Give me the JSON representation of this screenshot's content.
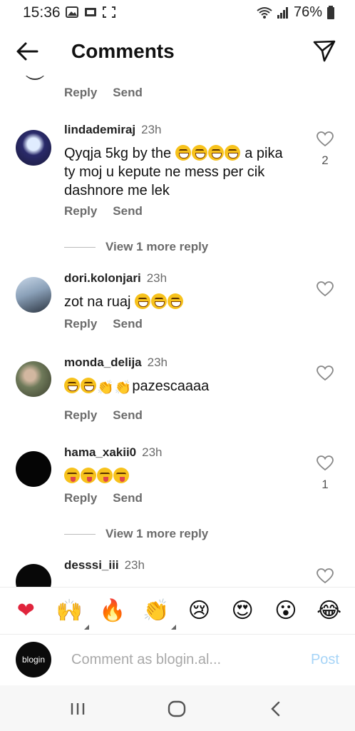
{
  "status": {
    "time": "15:36",
    "battery": "76%"
  },
  "header": {
    "title": "Comments"
  },
  "top": {
    "reply": "Reply",
    "send": "Send"
  },
  "comments": [
    {
      "username": "lindademiraj",
      "time": "23h",
      "text_lines": [
        "Qyqja 5kg by the",
        "a pika",
        "ty moj u kepute ne mess per cik",
        "dashnore me lek"
      ],
      "reply": "Reply",
      "send": "Send",
      "likes": "2"
    },
    {
      "username": "dori.kolonjari",
      "time": "23h",
      "text": "zot na ruaj",
      "reply": "Reply",
      "send": "Send"
    },
    {
      "username": "monda_delija",
      "time": "23h",
      "text": "pazescaaaa",
      "reply": "Reply",
      "send": "Send"
    },
    {
      "username": "hama_xakii0",
      "time": "23h",
      "reply": "Reply",
      "send": "Send",
      "likes": "1"
    },
    {
      "username": "desssi_iii",
      "time": "23h"
    }
  ],
  "view_more": [
    "View 1 more reply",
    "View 1 more reply"
  ],
  "reactions": [
    {
      "icon": "red-heart-icon",
      "glyph": "❤"
    },
    {
      "icon": "raising-hands-icon",
      "glyph": "🙌"
    },
    {
      "icon": "fire-icon",
      "glyph": "🔥"
    },
    {
      "icon": "clapping-hands-icon",
      "glyph": "👏"
    },
    {
      "icon": "crying-face-icon",
      "glyph": "😢"
    },
    {
      "icon": "heart-eyes-icon",
      "glyph": "😍"
    },
    {
      "icon": "surprised-face-icon",
      "glyph": "😮"
    },
    {
      "icon": "tears-of-joy-icon",
      "glyph": "😂"
    }
  ],
  "compose": {
    "avatar_text": "blogin",
    "placeholder": "Comment as blogin.al...",
    "post": "Post"
  },
  "colors": {
    "heart": "#e0243c",
    "post": "#a6d4f7",
    "muted": "#6b6b6b"
  }
}
